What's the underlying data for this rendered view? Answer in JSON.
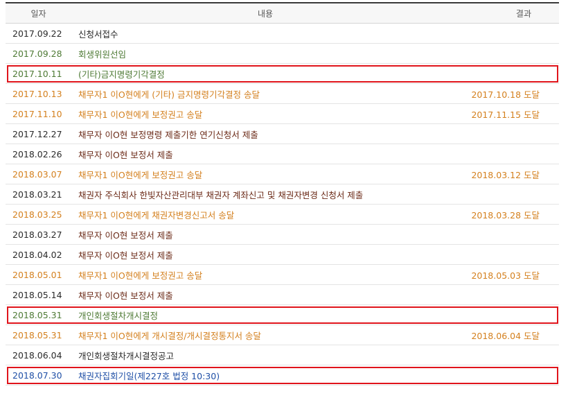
{
  "header": {
    "date": "일자",
    "content": "내용",
    "result": "결과"
  },
  "rows": [
    {
      "date": "2017.09.22",
      "content": "신청서접수",
      "result": ""
    },
    {
      "date": "2017.09.28",
      "content": "회생위원선임",
      "result": ""
    },
    {
      "date": "2017.10.11",
      "content": "(기타)금지명령기각결정",
      "result": ""
    },
    {
      "date": "2017.10.13",
      "content": "채무자1 이O현에게 (기타) 금지명령기각결정 송달",
      "result": "2017.10.18 도달"
    },
    {
      "date": "2017.11.10",
      "content": "채무자1 이O현에게 보정권고 송달",
      "result": "2017.11.15 도달"
    },
    {
      "date": "2017.12.27",
      "content": "채무자 이O현 보정명령 제출기한 연기신청서 제출",
      "result": ""
    },
    {
      "date": "2018.02.26",
      "content": "채무자 이O현 보정서 제출",
      "result": ""
    },
    {
      "date": "2018.03.07",
      "content": "채무자1 이O현에게 보정권고 송달",
      "result": "2018.03.12 도달"
    },
    {
      "date": "2018.03.21",
      "content": "채권자 주식회사 한빛자산관리대부 채권자 계좌신고 및 채권자변경 신청서 제출",
      "result": ""
    },
    {
      "date": "2018.03.25",
      "content": "채무자1 이O현에게 채권자변경신고서 송달",
      "result": "2018.03.28 도달"
    },
    {
      "date": "2018.03.27",
      "content": "채무자 이O현 보정서 제출",
      "result": ""
    },
    {
      "date": "2018.04.02",
      "content": "채무자 이O현 보정서 제출",
      "result": ""
    },
    {
      "date": "2018.05.01",
      "content": "채무자1 이O현에게 보정권고 송달",
      "result": "2018.05.03 도달"
    },
    {
      "date": "2018.05.14",
      "content": "채무자 이O현 보정서 제출",
      "result": ""
    },
    {
      "date": "2018.05.31",
      "content": "개인회생절차개시결정",
      "result": ""
    },
    {
      "date": "2018.05.31",
      "content": "채무자1 이O현에게 개시결정/개시결정통지서 송달",
      "result": "2018.06.04 도달"
    },
    {
      "date": "2018.06.04",
      "content": "개인회생절차개시결정공고",
      "result": ""
    },
    {
      "date": "2018.07.30",
      "content": "채권자집회기일(제227호 법정 10:30)",
      "result": ""
    }
  ],
  "colors": {
    "black": "#2a2a2a",
    "green": "#4e7a35",
    "orange": "#d4801e",
    "darkred": "#6b2a17",
    "blue": "#1f4fa6",
    "highlight": "#e0141b"
  }
}
